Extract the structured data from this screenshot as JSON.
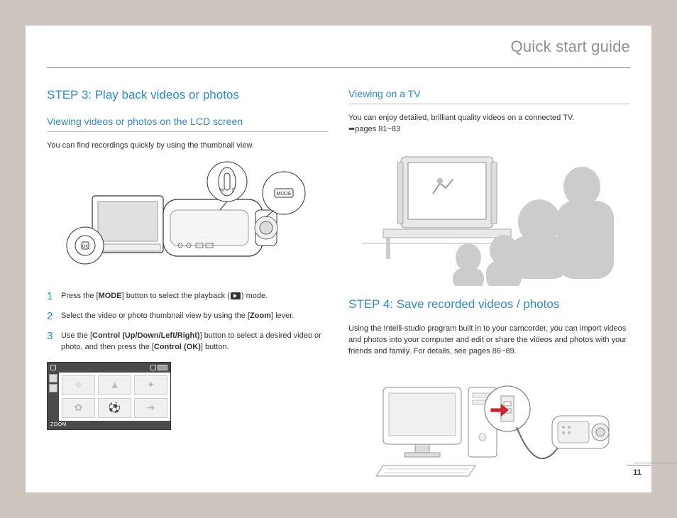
{
  "header": {
    "title": "Quick start guide"
  },
  "left": {
    "step_heading": "STEP 3: Play back videos or photos",
    "sub_heading": "Viewing videos or photos on the LCD screen",
    "intro": "You can find recordings quickly by using the thumbnail view.",
    "mode_label": "MODE",
    "ok_label": "OK",
    "zoom_letters": {
      "w": "W",
      "t": "T"
    },
    "steps": [
      {
        "num": "1",
        "pre": "Press the [",
        "bold": "MODE",
        "post": "] button to select the playback (",
        "post2": ") mode."
      },
      {
        "num": "2",
        "pre": "Select the video or photo thumbnail view by using the [",
        "bold": "Zoom",
        "post": "] lever."
      },
      {
        "num": "3",
        "pre": "Use the [",
        "bold": "Control (Up/Down/Left/Right)",
        "mid": "] button to select a desired video or photo, and then press the [",
        "bold2": "Control (OK)",
        "post": "] button."
      }
    ],
    "thumb_foot": "ZOOM"
  },
  "right": {
    "sub_heading": "Viewing on a TV",
    "tv_text": "You can enjoy detailed, brilliant quality videos on a connected TV.",
    "tv_ref": "➥pages 81~83",
    "step4_heading": "STEP 4: Save recorded videos / photos",
    "step4_text": "Using the Intelli-studio program built in to your camcorder, you can import videos and photos into your computer and edit or share the videos and photos with your friends and family. For details, see pages 86~89."
  },
  "page_number": "11"
}
